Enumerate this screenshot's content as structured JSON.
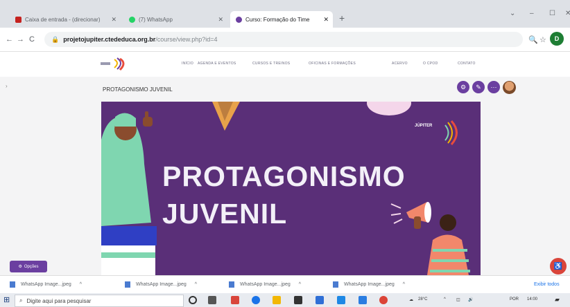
{
  "browser": {
    "tabs": [
      {
        "title": "Caixa de entrada - (direcionar)",
        "fav": "#c5221f"
      },
      {
        "title": "(7) WhatsApp",
        "fav": "#25d366"
      },
      {
        "title": "Curso: Formação do Time",
        "fav": "#6b3fa0"
      }
    ],
    "new_tab": "+",
    "address": {
      "host": "projetojupiter.ctededuca.org.br",
      "path": "/course/view.php?id=4"
    },
    "profile_initial": "D"
  },
  "site": {
    "nav": [
      "INÍCIO",
      "AGENDA E EVENTOS",
      "CURSOS E TREINOS",
      "OFICINAS E FORMAÇÕES",
      "ACERVO",
      "O CPOD",
      "CONTATO"
    ],
    "page_title": "PROTAGONISMO JUVENIL",
    "banner": {
      "line1": "PROTAGONISMO",
      "line2": "JUVENIL",
      "logo_text": "JÚPITER"
    },
    "options_button": "Opções"
  },
  "downloads": {
    "items": [
      "WhatsApp Image...jpeg",
      "WhatsApp Image...jpeg",
      "WhatsApp Image...jpeg",
      "WhatsApp Image...jpeg"
    ],
    "show_all": "Exibir todos"
  },
  "taskbar": {
    "search_placeholder": "Digite aqui para pesquisar",
    "weather": "28°C",
    "lang": "POR",
    "time": "14:00"
  }
}
